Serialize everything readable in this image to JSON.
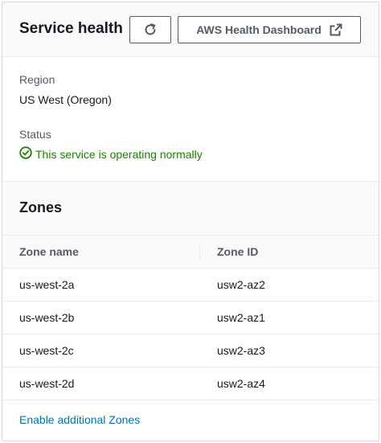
{
  "header": {
    "title": "Service health",
    "refresh_icon": "refresh-icon",
    "dashboard_label": "AWS Health Dashboard",
    "external_icon": "external-link-icon"
  },
  "details": {
    "region_label": "Region",
    "region_value": "US West (Oregon)",
    "status_label": "Status",
    "status_icon": "check-circle-icon",
    "status_value": "This service is operating normally",
    "status_color": "#1d8102"
  },
  "zones": {
    "title": "Zones",
    "columns": [
      "Zone name",
      "Zone ID"
    ],
    "rows": [
      [
        "us-west-2a",
        "usw2-az2"
      ],
      [
        "us-west-2b",
        "usw2-az1"
      ],
      [
        "us-west-2c",
        "usw2-az3"
      ],
      [
        "us-west-2d",
        "usw2-az4"
      ]
    ],
    "enable_link": "Enable additional Zones"
  },
  "colors": {
    "link": "#0073bb",
    "header_bg": "#fafafa",
    "border": "#eaeded"
  }
}
